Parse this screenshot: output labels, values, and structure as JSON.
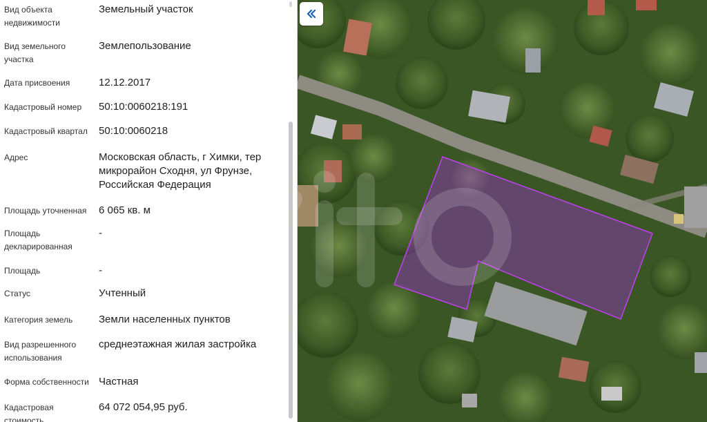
{
  "properties": [
    {
      "label": "Вид объекта недвижимости",
      "value": "Земельный участок"
    },
    {
      "label": "Вид земельного участка",
      "value": "Землепользование"
    },
    {
      "label": "Дата присвоения",
      "value": "12.12.2017"
    },
    {
      "label": "Кадастровый номер",
      "value": "50:10:0060218:191"
    },
    {
      "label": "Кадастровый квартал",
      "value": "50:10:0060218"
    },
    {
      "label": "Адрес",
      "value": "Московская область, г Химки, тер микрорайон Сходня, ул Фрунзе, Российская Федерация"
    },
    {
      "label": "Площадь уточненная",
      "value": "6 065 кв. м"
    },
    {
      "label": "Площадь декларированная",
      "value": "-"
    },
    {
      "label": "Площадь",
      "value": "-"
    },
    {
      "label": "Статус",
      "value": "Учтенный"
    },
    {
      "label": "Категория земель",
      "value": "Земли населенных пунктов"
    },
    {
      "label": "Вид разрешенного использования",
      "value": "среднеэтажная жилая застройка"
    },
    {
      "label": "Форма собственности",
      "value": "Частная"
    },
    {
      "label": "Кадастровая стоимость",
      "value": "64 072 054,95 руб."
    }
  ],
  "map": {
    "collapse_icon": "double-chevron-left-icon",
    "parcel_color": "#9b2fd0",
    "accent_color": "#1a5fb4",
    "watermark": "avito"
  }
}
